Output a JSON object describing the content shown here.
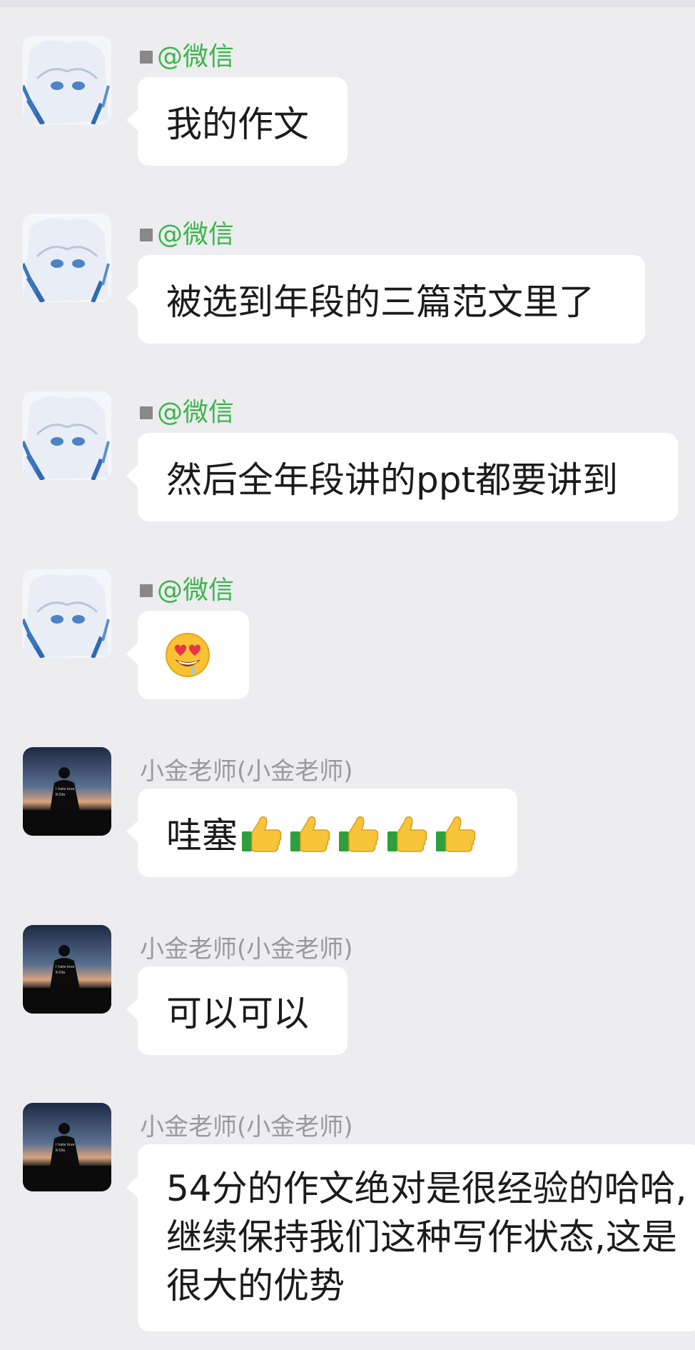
{
  "chat": {
    "messages": [
      {
        "sender": "@微信",
        "text": "我的作文"
      },
      {
        "sender": "@微信",
        "text": "被选到年段的三篇范文里了"
      },
      {
        "sender": "@微信",
        "text": "然后全年段讲的ppt都要讲到"
      },
      {
        "sender": "@微信",
        "emoji": "😍",
        "icon": "heart-eyes-drooling-emoji"
      },
      {
        "sender": "小金老师(小金老师)",
        "text": "哇塞",
        "icon": "thumbs-up-emoji",
        "repeat": 5
      },
      {
        "sender": "小金老师(小金老师)",
        "text": "可以可以"
      },
      {
        "sender": "小金老师(小金老师)",
        "text": "54分的作文绝对是很经验的哈哈,继续保持我们这种写作状态,这是很大的优势"
      }
    ]
  },
  "colors": {
    "background": "#ededf0",
    "bubble": "#ffffff",
    "wechat_green": "#3bb54a",
    "sender_gray": "#9a9a9a"
  }
}
